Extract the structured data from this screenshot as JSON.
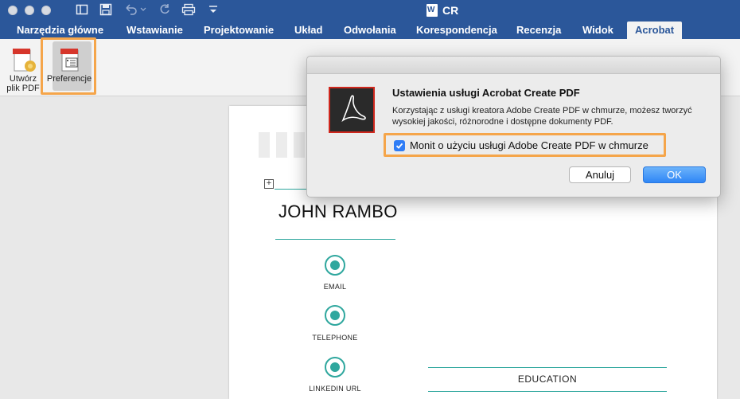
{
  "window": {
    "title": "CR"
  },
  "toolbar": {
    "icons": [
      "sidebar-toggle-icon",
      "save-icon",
      "undo-icon",
      "redo-icon",
      "print-icon",
      "customize-toolbar-icon"
    ]
  },
  "tabs": [
    {
      "label": "Narzędzia główne"
    },
    {
      "label": "Wstawianie"
    },
    {
      "label": "Projektowanie"
    },
    {
      "label": "Układ"
    },
    {
      "label": "Odwołania"
    },
    {
      "label": "Korespondencja"
    },
    {
      "label": "Recenzja"
    },
    {
      "label": "Widok"
    },
    {
      "label": "Acrobat",
      "active": true
    }
  ],
  "ribbon": {
    "create_pdf": {
      "line1": "Utwórz",
      "line2": "plik PDF"
    },
    "preferences": {
      "label": "Preferencje"
    }
  },
  "document": {
    "name": "JOHN RAMBO",
    "contacts": [
      {
        "label": "EMAIL",
        "icon": "email-icon"
      },
      {
        "label": "TELEPHONE",
        "icon": "telephone-icon"
      },
      {
        "label": "LINKEDIN URL",
        "icon": "linkedin-icon"
      }
    ],
    "section_education": "EDUCATION"
  },
  "dialog": {
    "title": "Ustawienia usługi Acrobat Create PDF",
    "description": "Korzystając z usługi kreatora Adobe Create PDF w chmurze, możesz tworzyć wysokiej jakości, różnorodne i dostępne dokumenty PDF.",
    "checkbox_label": "Monit o użyciu usługi Adobe Create PDF w chmurze",
    "checkbox_checked": true,
    "cancel_label": "Anuluj",
    "ok_label": "OK"
  },
  "colors": {
    "word_blue": "#2b579a",
    "highlight_orange": "#f5a54a",
    "teal_accent": "#2fa79e",
    "adobe_red": "#d0271d",
    "ok_blue": "#2f86f6"
  }
}
